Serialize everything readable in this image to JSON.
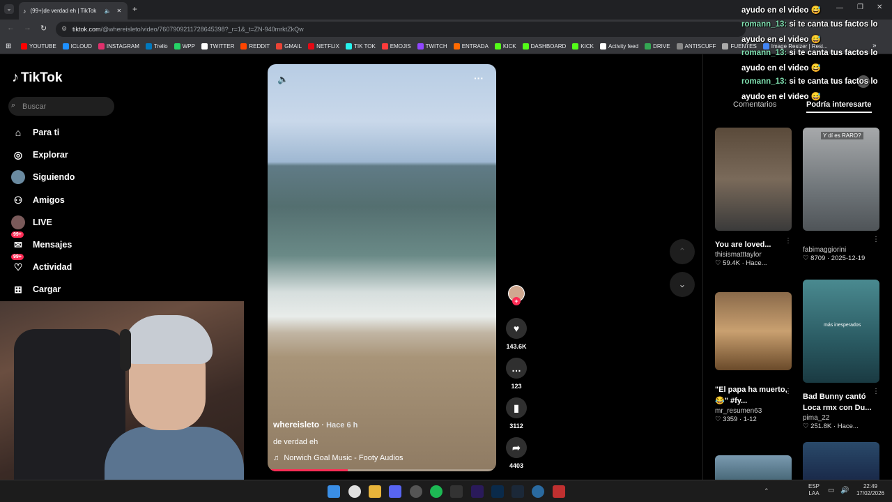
{
  "browser": {
    "tab_title": "(99+)de verdad eh | TikTok",
    "url_main": "tiktok.com",
    "url_rest": "/@whereisleto/video/7607909211728645398?_r=1&_t=ZN-940mrktZkQw",
    "bookmarks": [
      "YOUTUBE",
      "ICLOUD",
      "INSTAGRAM",
      "Trello",
      "WPP",
      "TWITTER",
      "REDDIT",
      "GMAIL",
      "NETFLIX",
      "TIK TOK",
      "EMOJIS",
      "TWITCH",
      "ENTRADA",
      "KICK",
      "DASHBOARD",
      "KICK",
      "Activity feed",
      "DRIVE",
      "ANTISCUFF",
      "FUENTES",
      "Image Resizer | Resi..."
    ],
    "bookmark_colors": [
      "#ff0000",
      "#1e90ff",
      "#e1306c",
      "#0079bf",
      "#25d366",
      "#ffffff",
      "#ff4500",
      "#ea4335",
      "#e50914",
      "#25f4ee",
      "#ff3b3b",
      "#9146ff",
      "#ff6a00",
      "#53fc18",
      "#53fc18",
      "#53fc18",
      "#ffffff",
      "#34a853",
      "#888888",
      "#aaaaaa",
      "#4285f4"
    ]
  },
  "app": {
    "logo": "TikTok",
    "search_placeholder": "Buscar",
    "nav": [
      {
        "label": "Para ti",
        "icon": "home-icon"
      },
      {
        "label": "Explorar",
        "icon": "compass-icon"
      },
      {
        "label": "Siguiendo",
        "icon": "avatar-icon"
      },
      {
        "label": "Amigos",
        "icon": "friends-icon"
      },
      {
        "label": "LIVE",
        "icon": "live-icon"
      },
      {
        "label": "Mensajes",
        "icon": "messages-icon",
        "badge": "99+"
      },
      {
        "label": "Actividad",
        "icon": "activity-icon",
        "badge": "99+"
      },
      {
        "label": "Cargar",
        "icon": "upload-icon"
      }
    ]
  },
  "video": {
    "author": "whereisleto",
    "time": "· Hace 6 h",
    "caption": "de verdad eh",
    "music": "Norwich Goal Music - Footy Audios",
    "progress": 0.35
  },
  "actions": {
    "likes": "143.6K",
    "comments": "123",
    "saves": "3112",
    "shares": "4403"
  },
  "panel": {
    "tab_comments": "Comentarios",
    "tab_suggested": "Podría interesarte",
    "cards": [
      {
        "title": "You are loved...",
        "user": "thisismatttaylor",
        "stats": "♡ 59.4K · Hace...",
        "color": "#6b5a4a"
      },
      {
        "title": "",
        "user": "fabimaggiorini",
        "stats": "♡ 8709 · 2025-12-19",
        "color": "#8a8f94",
        "overlay": "Y dí es RARO?"
      },
      {
        "title": "\"El papa ha muerto, 😂\" #fy...",
        "user": "mr_resumen63",
        "stats": "♡ 3359 · 1-12",
        "color": "#b08a5a"
      },
      {
        "title": "Bad Bunny cantó Loca rmx con Du...",
        "user": "pima_22",
        "stats": "♡ 251.8K · Hace...",
        "color": "#3a7f86",
        "overlay": "más inesperados"
      }
    ]
  },
  "chat": {
    "user": "romann_13:",
    "message": "si te canta tus factos lo",
    "tail": "ayudo en el video"
  },
  "taskbar": {
    "lang": "ESP",
    "region": "LAA",
    "time": "22:49",
    "date": "17/02/2026"
  }
}
